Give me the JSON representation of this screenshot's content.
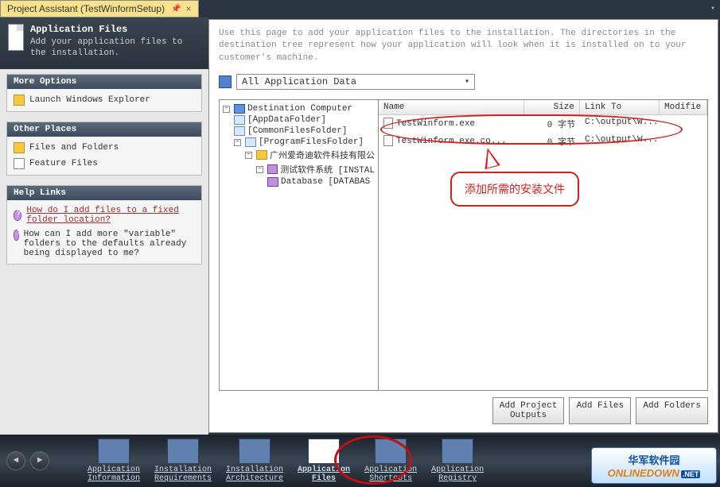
{
  "tab": {
    "title": "Project Assistant (TestWinformSetup)"
  },
  "header": {
    "title": "Application Files",
    "subtitle": "Add your application files to the installation."
  },
  "sections": {
    "more_options": {
      "title": "More Options",
      "items": [
        {
          "label": "Launch Windows Explorer"
        }
      ]
    },
    "other_places": {
      "title": "Other Places",
      "items": [
        {
          "label": "Files and Folders"
        },
        {
          "label": "Feature Files"
        }
      ]
    },
    "help_links": {
      "title": "Help Links",
      "items": [
        {
          "label": "How do I add files to a fixed folder location?",
          "link": true
        },
        {
          "label": "How can I add more \"variable\" folders to the defaults already being displayed to me?",
          "link": false
        }
      ]
    }
  },
  "description": "Use this page to add your application files to the installation. The directories in the destination tree represent how your application will look when it is installed on to your customer's machine.",
  "dropdown": {
    "selected": "All Application Data"
  },
  "tree": {
    "root": "Destination Computer",
    "items": [
      {
        "label": "[AppDataFolder]"
      },
      {
        "label": "[CommonFilesFolder]"
      },
      {
        "label": "[ProgramFilesFolder]",
        "children": [
          {
            "label": "广州爱奇迪软件科技有限公",
            "children": [
              {
                "label": "测试软件系统 [INSTAL",
                "children": [
                  {
                    "label": "Database [DATABAS"
                  }
                ]
              }
            ]
          }
        ]
      }
    ]
  },
  "file_list": {
    "columns": {
      "name": "Name",
      "size": "Size",
      "linkto": "Link To",
      "modified": "Modifie"
    },
    "rows": [
      {
        "name": "TestWinform.exe",
        "size": "0 字节",
        "linkto": "C:\\output\\W..."
      },
      {
        "name": "TestWinform.exe.co...",
        "size": "0 字节",
        "linkto": "C:\\output\\W..."
      }
    ]
  },
  "callout": "添加所需的安装文件",
  "buttons": {
    "add_project": "Add Project\nOutputs",
    "add_files": "Add Files",
    "add_folders": "Add Folders"
  },
  "nav": {
    "items": [
      {
        "label": "Application\nInformation"
      },
      {
        "label": "Installation\nRequirements"
      },
      {
        "label": "Installation\nArchitecture"
      },
      {
        "label": "Application\nFiles",
        "active": true
      },
      {
        "label": "Application\nShortcuts"
      },
      {
        "label": "Application\nRegistry"
      }
    ]
  },
  "watermark": {
    "cn": "华军软件园",
    "en_pre": "ONLINE",
    "en_post": "DOWN",
    "suffix": ".NET"
  }
}
